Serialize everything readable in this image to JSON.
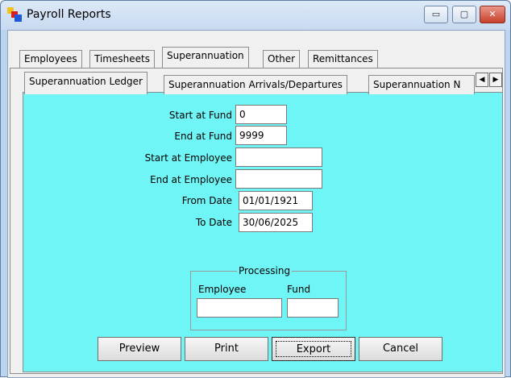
{
  "window": {
    "title": "Payroll Reports",
    "controls": {
      "minimize": "▭",
      "maximize": "▢",
      "close": "✕"
    }
  },
  "outer_tabs": [
    "Employees",
    "Timesheets",
    "Superannuation",
    "Other",
    "Remittances"
  ],
  "active_outer_tab": "Superannuation",
  "inner_tabs": [
    "Superannuation Ledger",
    "Superannuation Arrivals/Departures",
    "Superannuation N"
  ],
  "active_inner_tab": "Superannuation Ledger",
  "tab_scroll": {
    "left": "◀",
    "right": "▶"
  },
  "form": {
    "start_fund": {
      "label": "Start at Fund",
      "value": "0"
    },
    "end_fund": {
      "label": "End at Fund",
      "value": "9999"
    },
    "start_employee": {
      "label": "Start at Employee",
      "value": ""
    },
    "end_employee": {
      "label": "End at Employee",
      "value": ""
    },
    "from_date": {
      "label": "From Date",
      "value": "01/01/1921"
    },
    "to_date": {
      "label": "To Date",
      "value": "30/06/2025"
    }
  },
  "processing": {
    "title": "Processing",
    "employee_label": "Employee",
    "fund_label": "Fund",
    "employee_value": "",
    "fund_value": ""
  },
  "buttons": {
    "preview": "Preview",
    "print": "Print",
    "export": "Export",
    "cancel": "Cancel"
  },
  "colors": {
    "panel_bg": "#6ff5f5",
    "window_frame": "#bcd4ee",
    "close_red": "#c7402b"
  }
}
